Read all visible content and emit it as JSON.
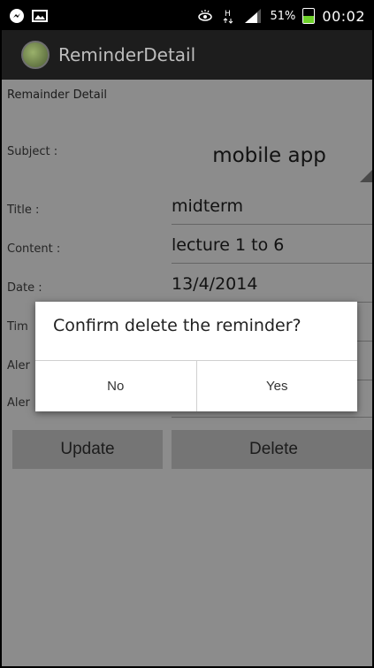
{
  "statusbar": {
    "icons": [
      "messenger-icon",
      "image-icon",
      "eye-icon",
      "h-data-icon",
      "signal-icon"
    ],
    "battery_percent": "51%",
    "battery_level": 0.51,
    "time": "00:02"
  },
  "actionbar": {
    "title": "ReminderDetail"
  },
  "form": {
    "section_title": "Remainder Detail",
    "subject_label": "Subject :",
    "subject_value": "mobile app",
    "title_label": "Title :",
    "title_value": "midterm",
    "content_label": "Content :",
    "content_value": "lecture 1 to 6",
    "date_label": "Date :",
    "date_value": "13/4/2014",
    "time_label": "Tim",
    "alert1_label": "Aler",
    "alert2_label": "Aler"
  },
  "buttons": {
    "update": "Update",
    "delete": "Delete"
  },
  "dialog": {
    "message": "Confirm delete the reminder?",
    "no": "No",
    "yes": "Yes"
  },
  "colors": {
    "battery_fill": "#6ed12a",
    "actionbar": "#1d1d1d"
  }
}
